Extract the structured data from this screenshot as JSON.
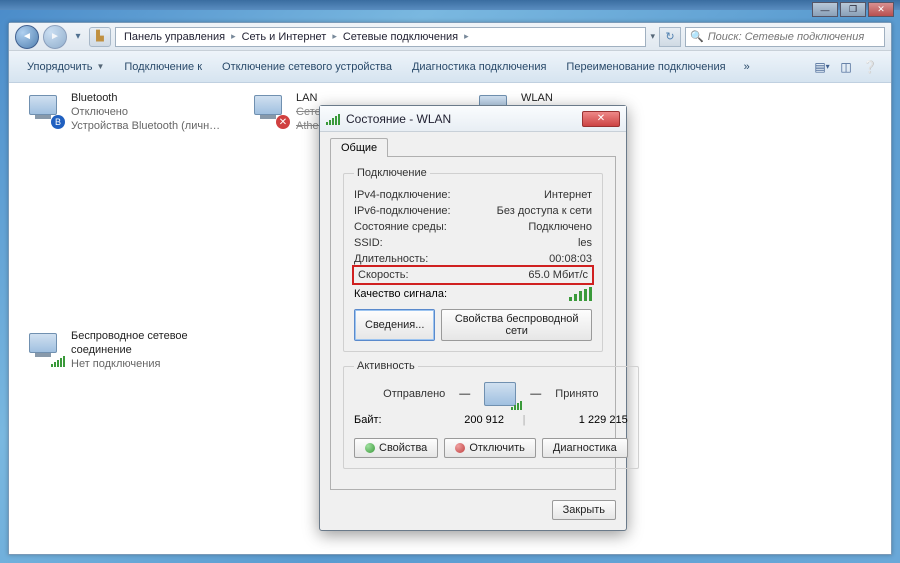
{
  "outer_controls": {
    "min": "—",
    "max": "❐",
    "close": "✕"
  },
  "addrbar": {
    "back": "◄",
    "fwd": "►",
    "up": "▲",
    "crumbs": [
      "Панель управления",
      "Сеть и Интернет",
      "Сетевые подключения"
    ],
    "refresh": "↻",
    "search_placeholder": "Поиск: Сетевые подключения"
  },
  "toolbar": {
    "items": [
      "Упорядочить",
      "Подключение к",
      "Отключение сетевого устройства",
      "Диагностика подключения",
      "Переименование подключения"
    ],
    "overflow": "»"
  },
  "connections": [
    {
      "name": "Bluetooth",
      "status": "Отключено",
      "device": "Устройства Bluetooth (личной с...",
      "badge": "bt"
    },
    {
      "name": "LAN",
      "status": "Сетевой кабель не подключен",
      "device": "Atheros",
      "struck": true,
      "badge": "x"
    },
    {
      "name": "WLAN",
      "status": "les",
      "device": "",
      "badge": "bars"
    },
    {
      "name": "Беспроводное сетевое соединение",
      "status": "Нет подключения",
      "device": "",
      "badge": "bars"
    }
  ],
  "dlg": {
    "title": "Состояние - WLAN",
    "tab": "Общие",
    "group_conn": "Подключение",
    "rows": {
      "ipv4_l": "IPv4-подключение:",
      "ipv4_v": "Интернет",
      "ipv6_l": "IPv6-подключение:",
      "ipv6_v": "Без доступа к сети",
      "media_l": "Состояние среды:",
      "media_v": "Подключено",
      "ssid_l": "SSID:",
      "ssid_v": "les",
      "dur_l": "Длительность:",
      "dur_v": "00:08:03",
      "speed_l": "Скорость:",
      "speed_v": "65.0 Мбит/с",
      "quality_l": "Качество сигнала:"
    },
    "btn_details": "Сведения...",
    "btn_wprops": "Свойства беспроводной сети",
    "group_act": "Активность",
    "act_sent": "Отправлено",
    "act_recv": "Принято",
    "bytes_l": "Байт:",
    "bytes_sent": "200 912",
    "bytes_recv": "1 229 215",
    "btn_props": "Свойства",
    "btn_disable": "Отключить",
    "btn_diag": "Диагностика",
    "btn_close": "Закрыть"
  }
}
